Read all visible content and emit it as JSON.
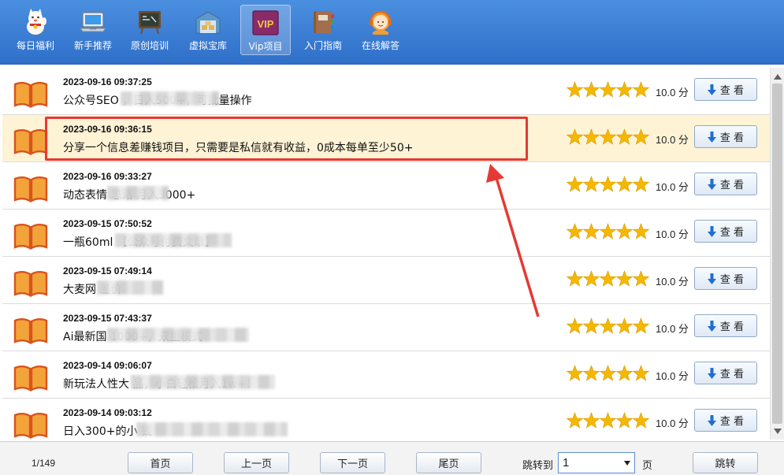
{
  "nav": {
    "items": [
      {
        "label": "每日福利",
        "icon": "lucky-cat-icon"
      },
      {
        "label": "新手推荐",
        "icon": "laptop-icon"
      },
      {
        "label": "原创培训",
        "icon": "blackboard-icon"
      },
      {
        "label": "虚拟宝库",
        "icon": "warehouse-icon"
      },
      {
        "label": "Vip项目",
        "icon": "vip-icon",
        "badge": "VIP",
        "active": true
      },
      {
        "label": "入门指南",
        "icon": "books-icon"
      },
      {
        "label": "在线解答",
        "icon": "support-agent-icon"
      }
    ]
  },
  "list": {
    "rows": [
      {
        "date": "2023-09-16 09:37:25",
        "title": "公众号SEO            ，日入500+，可批量操作",
        "score": "10.0 分",
        "rating": 5,
        "button": "查 看"
      },
      {
        "date": "2023-09-16 09:36:15",
        "title": "分享一个信息差赚钱项目，只需要是私信就有收益，0成本每单至少50+",
        "score": "10.0 分",
        "rating": 5,
        "button": "查 看",
        "selected": true
      },
      {
        "date": "2023-09-16 09:33:27",
        "title": "动态表情              思路 月入3000+",
        "score": "10.0 分",
        "rating": 5,
        "button": "查 看"
      },
      {
        "date": "2023-09-15 07:50:52",
        "title": "一瓶60ml                【公众号付费文章】",
        "score": "10.0 分",
        "rating": 5,
        "button": "查 看"
      },
      {
        "date": "2023-09-15 07:49:14",
        "title": "大麦网            差价",
        "score": "10.0 分",
        "rating": 5,
        "button": "查 看"
      },
      {
        "date": "2023-09-15 07:43:37",
        "title": "Ai最新国                      1000+，双重模式",
        "score": "10.0 分",
        "rating": 5,
        "button": "查 看"
      },
      {
        "date": "2023-09-14 09:06:07",
        "title": "新玩法人性大                          品，小白轻松月入1w+！",
        "score": "10.0 分",
        "rating": 5,
        "button": "查 看"
      },
      {
        "date": "2023-09-14 09:03:12",
        "title": "日入300+的小                              钱",
        "score": "10.0 分",
        "rating": 5,
        "button": "查 看"
      }
    ]
  },
  "pager": {
    "count": "1/149",
    "first": "首页",
    "prev": "上一页",
    "next": "下一页",
    "last": "尾页",
    "jump_label": "跳转到",
    "jump_value": "1",
    "unit": "页",
    "go": "跳转"
  },
  "colors": {
    "nav_bg": "#3a7bd5",
    "selected_row": "#fff3d6",
    "highlight": "#e53935",
    "star": "#f5b800"
  }
}
